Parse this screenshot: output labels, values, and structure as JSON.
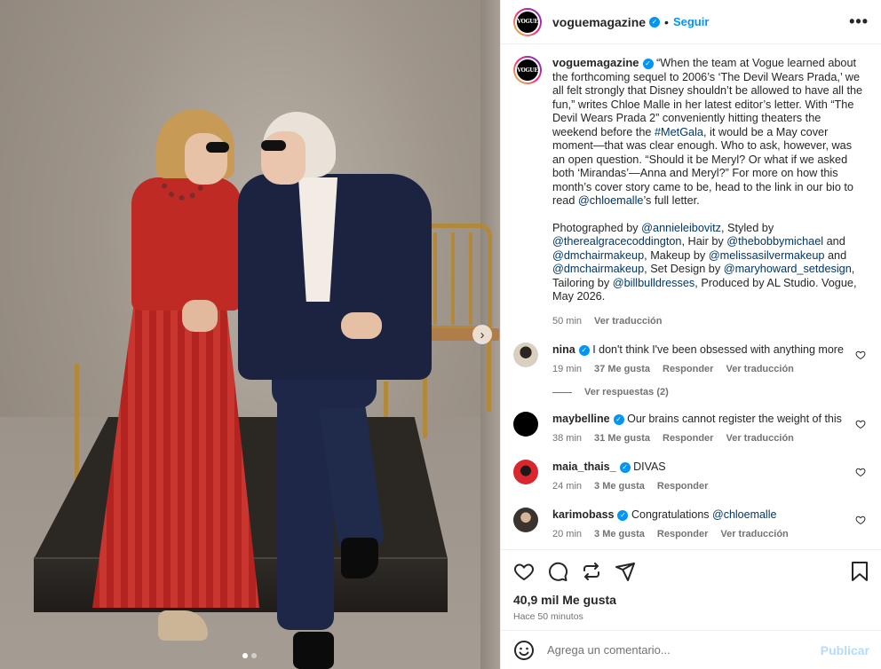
{
  "post": {
    "username": "voguemagazine",
    "avatar_text": "VOGUE",
    "follow_separator": "•",
    "follow_label": "Seguir",
    "more_label": "•••"
  },
  "caption": {
    "username": "voguemagazine",
    "text_1": "“When the team at Vogue learned about the forthcoming sequel to 2006’s ‘The Devil Wears Prada,’ we all felt strongly that Disney shouldn’t be allowed to have all the fun,” writes Chloe Malle in her latest editor’s letter. With “The Devil Wears Prada 2” conveniently hitting theaters the weekend before the ",
    "tag_metgala": "#MetGala",
    "text_2": ", it would be a May cover moment—that was clear enough. Who to ask, however, was an open question. “Should it be Meryl? Or what if we asked both ‘Mirandas’—Anna and Meryl?” For more on how this month’s cover story came to be, head to the link in our bio to read ",
    "mention_chloe": "@chloemalle",
    "text_3": "’s full letter.",
    "credits_1": "Photographed by ",
    "m_annie": "@annieleibovitz",
    "credits_2": ", Styled by ",
    "m_grace": "@therealgracecoddington",
    "credits_3": ", Hair by ",
    "m_bobby": "@thebobbymichael",
    "credits_4": " and ",
    "m_dmc1": "@dmchairmakeup",
    "credits_5": ", Makeup by ",
    "m_melissa": "@melissasilvermakeup",
    "credits_6": " and ",
    "m_dmc2": "@dmchairmakeup",
    "credits_7": ", Set Design by ",
    "m_mary": "@maryhoward_setdesign",
    "credits_8": ", Tailoring by ",
    "m_bill": "@billbulldresses",
    "credits_9": ", Produced by AL Studio. Vogue, May 2026.",
    "time": "50 min",
    "translate": "Ver traducción"
  },
  "comments": [
    {
      "username": "nina",
      "verified": true,
      "text": "I don't think I've been obsessed with anything more",
      "time": "19 min",
      "likes": "37 Me gusta",
      "reply": "Responder",
      "translate": "Ver traducción",
      "avatar_color": "#c9c2b5"
    },
    {
      "username": "maybelline",
      "verified": true,
      "text": "Our brains cannot register the weight of this",
      "time": "38 min",
      "likes": "31 Me gusta",
      "reply": "Responder",
      "translate": "Ver traducción",
      "avatar_color": "#000000"
    },
    {
      "username": "maia_thais_",
      "verified": true,
      "text": "DIVAS",
      "time": "24 min",
      "likes": "3 Me gusta",
      "reply": "Responder",
      "avatar_color": "#d8272f"
    },
    {
      "username": "karimobass",
      "verified": true,
      "text_prefix": "Congratulations ",
      "mention": "@chloemalle",
      "time": "20 min",
      "likes": "3 Me gusta",
      "reply": "Responder",
      "translate": "Ver traducción",
      "avatar_color": "#3a3330"
    }
  ],
  "view_replies": "Ver respuestas (2)",
  "footer": {
    "likes": "40,9 mil Me gusta",
    "ago": "Hace 50 minutos",
    "comment_placeholder": "Agrega un comentario...",
    "publish": "Publicar"
  },
  "colors": {
    "accent": "#0095f6",
    "link": "#00376b",
    "muted": "#737373"
  }
}
